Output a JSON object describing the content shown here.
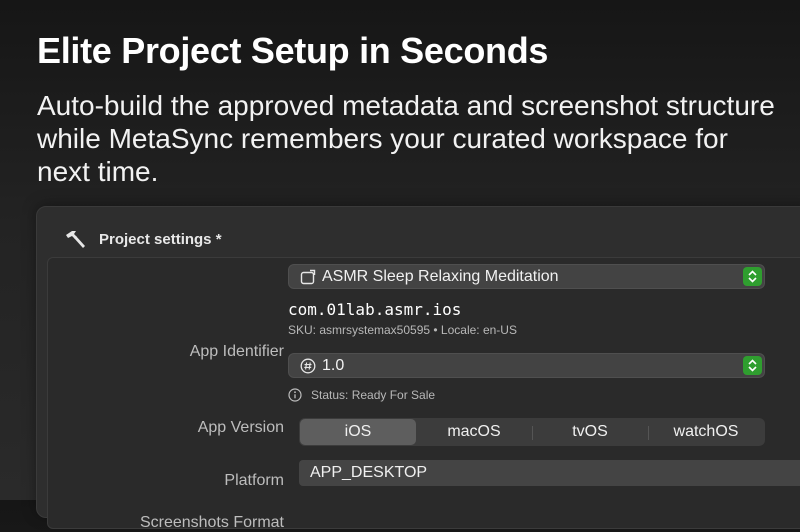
{
  "hero": {
    "title": "Elite Project Setup in Seconds",
    "subtitle": "Auto-build the approved metadata and screenshot structure while MetaSync remembers your curated workspace for next time."
  },
  "panel": {
    "header_icon": "hammer-icon",
    "title": "Project settings *"
  },
  "app_identifier": {
    "label": "App Identifier",
    "selected_app": "ASMR Sleep Relaxing Meditation",
    "app_icon": "app-window-icon",
    "bundle_id": "com.01lab.asmr.ios",
    "meta": "SKU: asmrsystemax50595 • Locale: en-US"
  },
  "app_version": {
    "label": "App Version",
    "value": "1.0",
    "version_icon": "number-circle-icon",
    "status": "Status: Ready For Sale",
    "status_icon": "info-circle-icon"
  },
  "platform": {
    "label": "Platform",
    "options": [
      "iOS",
      "macOS",
      "tvOS",
      "watchOS"
    ],
    "selected": "iOS"
  },
  "screenshots_format": {
    "label": "Screenshots Format",
    "value": "APP_DESKTOP"
  },
  "colors": {
    "accent_green": "#2f9e2f",
    "background": "#1c1c1c",
    "panel": "#2e2e2e"
  }
}
